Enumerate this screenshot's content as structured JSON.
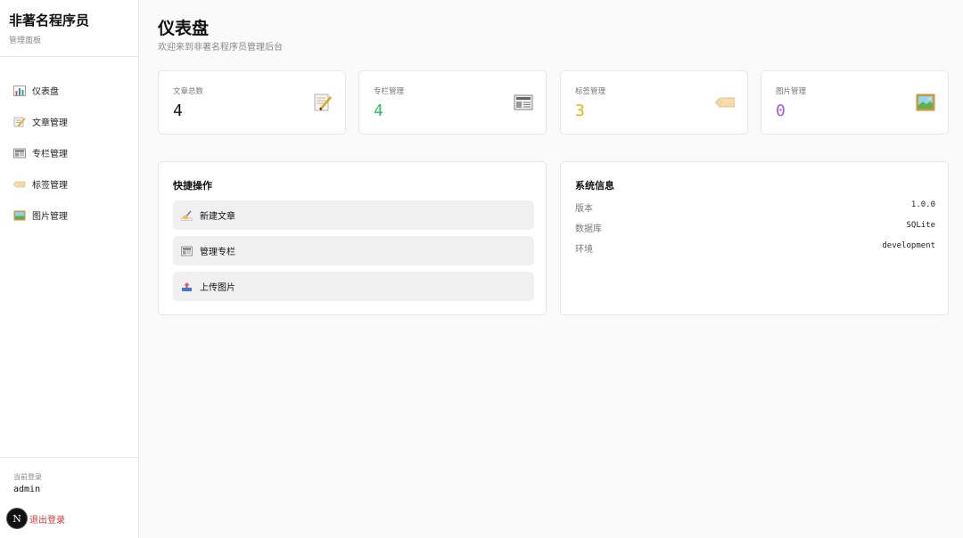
{
  "sidebar": {
    "brand_title": "非著名程序员",
    "brand_subtitle": "管理面板",
    "items": [
      {
        "label": "仪表盘",
        "icon": "bar-chart-icon"
      },
      {
        "label": "文章管理",
        "icon": "memo-icon"
      },
      {
        "label": "专栏管理",
        "icon": "newspaper-icon"
      },
      {
        "label": "标签管理",
        "icon": "tag-icon"
      },
      {
        "label": "图片管理",
        "icon": "framed-picture-icon"
      }
    ],
    "login_label": "当前登录",
    "login_user": "admin",
    "logout_label": "退出登录",
    "badge": "N"
  },
  "header": {
    "title": "仪表盘",
    "subtitle": "欢迎来到非著名程序员管理后台"
  },
  "stats": [
    {
      "label": "文章总数",
      "value": "4",
      "color": "#111111",
      "icon": "memo-icon"
    },
    {
      "label": "专栏管理",
      "value": "4",
      "color": "#22c55e",
      "icon": "newspaper-icon"
    },
    {
      "label": "标签管理",
      "value": "3",
      "color": "#eab308",
      "icon": "tag-icon"
    },
    {
      "label": "图片管理",
      "value": "0",
      "color": "#a855f7",
      "icon": "framed-picture-icon"
    }
  ],
  "quick_actions": {
    "title": "快捷操作",
    "items": [
      {
        "label": "新建文章",
        "icon": "writing-hand-icon"
      },
      {
        "label": "管理专栏",
        "icon": "newspaper-icon"
      },
      {
        "label": "上传图片",
        "icon": "inbox-upload-icon"
      }
    ]
  },
  "system_info": {
    "title": "系统信息",
    "rows": [
      {
        "key": "版本",
        "value": "1.0.0"
      },
      {
        "key": "数据库",
        "value": "SQLite"
      },
      {
        "key": "环境",
        "value": "development"
      }
    ]
  },
  "colors": {
    "accent_green": "#22c55e",
    "accent_yellow": "#eab308",
    "accent_purple": "#a855f7",
    "danger": "#d93636"
  }
}
